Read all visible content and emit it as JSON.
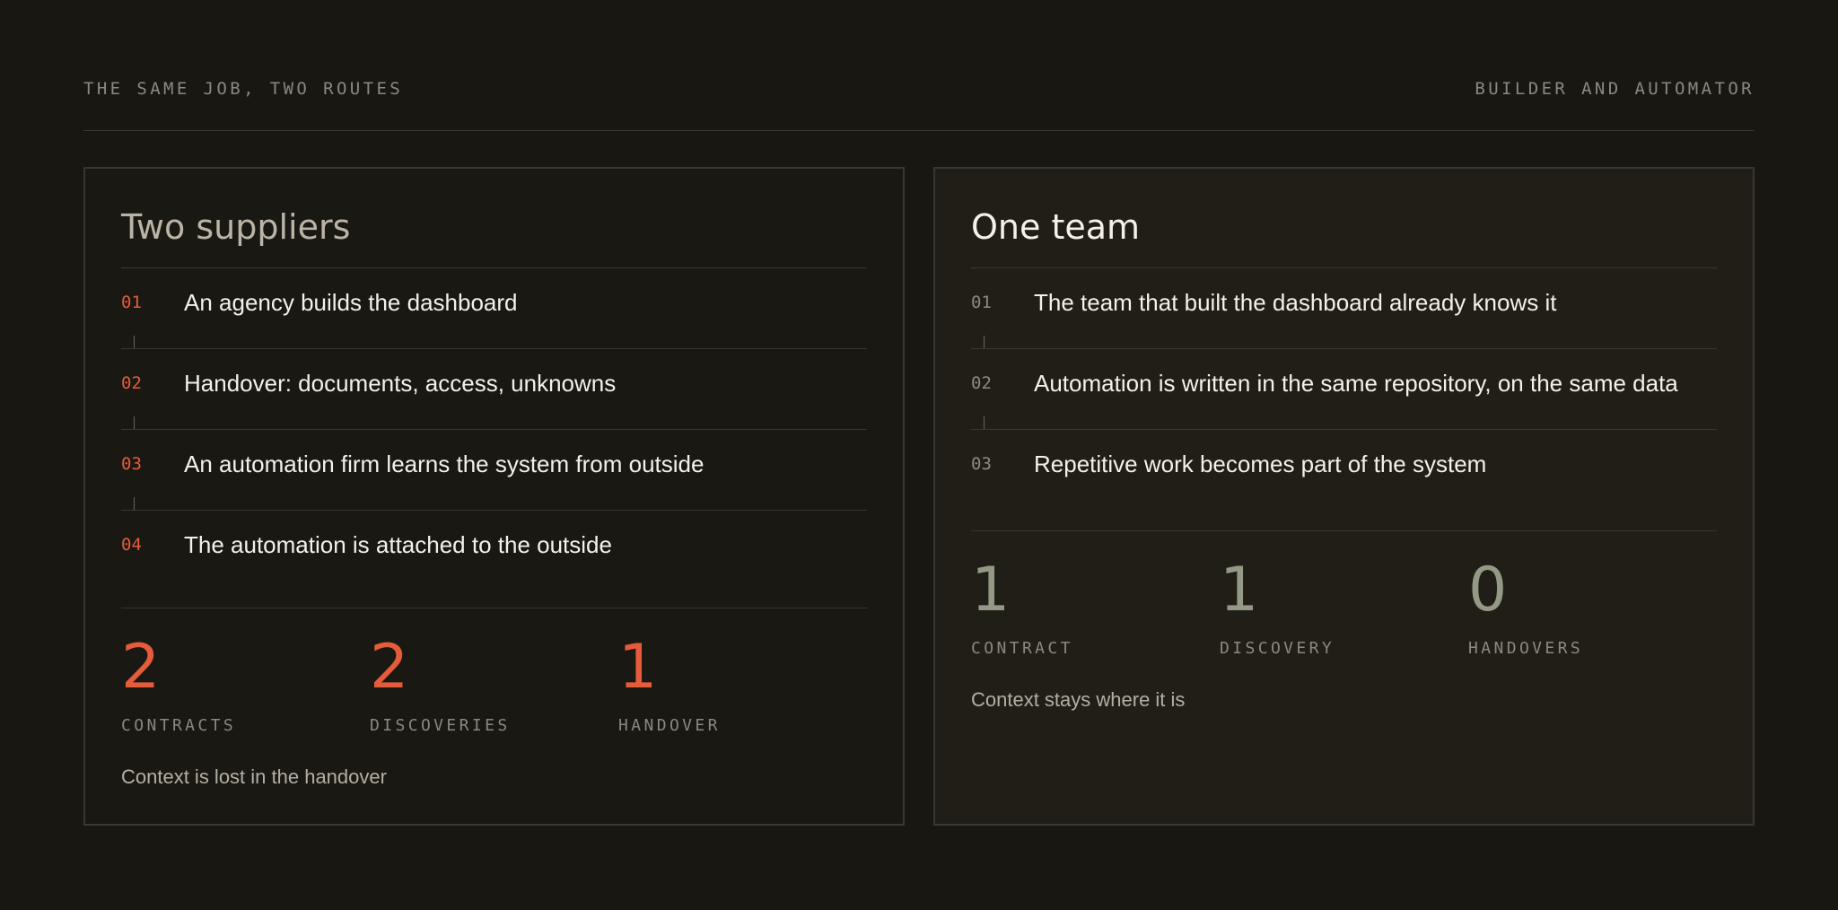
{
  "header": {
    "left_label": "THE SAME JOB, TWO ROUTES",
    "right_label": "BUILDER AND AUTOMATOR"
  },
  "left_panel": {
    "title": "Two suppliers",
    "steps": [
      {
        "num": "01",
        "text": "An agency builds the dashboard"
      },
      {
        "num": "02",
        "text": "Handover: documents, access, unknowns"
      },
      {
        "num": "03",
        "text": "An automation firm learns the system from outside"
      },
      {
        "num": "04",
        "text": "The automation is attached to the outside"
      }
    ],
    "stats": [
      {
        "value": "2",
        "label": "CONTRACTS"
      },
      {
        "value": "2",
        "label": "DISCOVERIES"
      },
      {
        "value": "1",
        "label": "HANDOVER"
      }
    ],
    "summary": "Context is lost in the handover"
  },
  "right_panel": {
    "title": "One team",
    "steps": [
      {
        "num": "01",
        "text": "The team that built the dashboard already knows it"
      },
      {
        "num": "02",
        "text": "Automation is written in the same repository, on the same data"
      },
      {
        "num": "03",
        "text": "Repetitive work becomes part of the system"
      }
    ],
    "stats": [
      {
        "value": "1",
        "label": "CONTRACT"
      },
      {
        "value": "1",
        "label": "DISCOVERY"
      },
      {
        "value": "0",
        "label": "HANDOVERS"
      }
    ],
    "summary": "Context stays where it is"
  },
  "colors": {
    "background": "#191712",
    "accent_orange": "#e45c3b",
    "accent_sage": "#939985",
    "rule": "#3a3731"
  }
}
